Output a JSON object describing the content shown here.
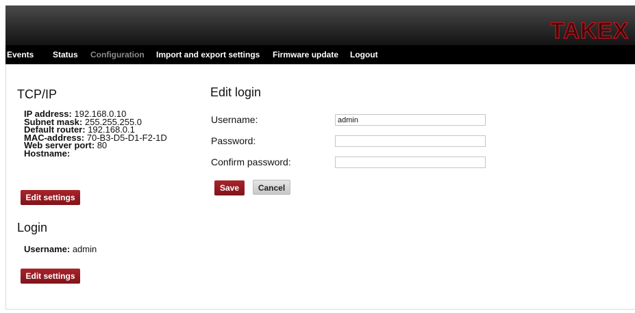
{
  "header": {
    "logo_text": "TAKEX",
    "logo_color": "#c8141e"
  },
  "nav": {
    "items": [
      {
        "label": "Events"
      },
      {
        "label": "Status"
      },
      {
        "label": "Configuration",
        "active": true
      },
      {
        "label": "Import and export settings"
      },
      {
        "label": "Firmware update"
      },
      {
        "label": "Logout"
      }
    ]
  },
  "tcpip": {
    "title": "TCP/IP",
    "rows": [
      {
        "label": "IP address:",
        "value": "192.168.0.10"
      },
      {
        "label": "Subnet mask:",
        "value": "255.255.255.0"
      },
      {
        "label": "Default router:",
        "value": "192.168.0.1"
      },
      {
        "label": "MAC-address:",
        "value": "70-B3-D5-D1-F2-1D"
      },
      {
        "label": "Web server port:",
        "value": "80"
      },
      {
        "label": "Hostname:",
        "value": ""
      }
    ],
    "edit_button": "Edit settings"
  },
  "login": {
    "title": "Login",
    "username_label": "Username:",
    "username_value": "admin",
    "edit_button": "Edit settings"
  },
  "edit_login": {
    "title": "Edit login",
    "username_label": "Username:",
    "username_value": "admin",
    "password_label": "Password:",
    "password_value": "",
    "confirm_label": "Confirm password:",
    "confirm_value": "",
    "save_button": "Save",
    "cancel_button": "Cancel"
  },
  "colors": {
    "accent_red": "#8f1a20",
    "nav_bg": "#000000",
    "nav_active": "#8c8c8c"
  }
}
